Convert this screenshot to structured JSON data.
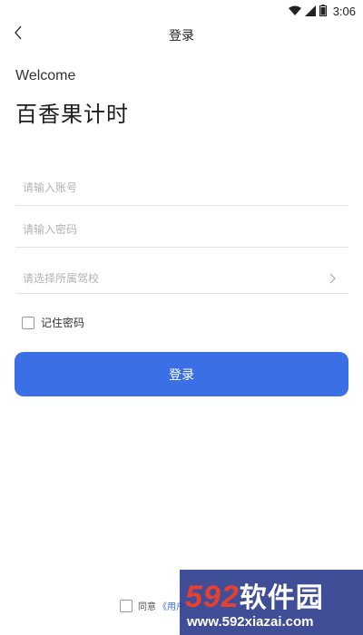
{
  "status_bar": {
    "time": "3:06",
    "icons": [
      "wifi-icon",
      "signal-icon",
      "battery-icon"
    ]
  },
  "nav": {
    "title": "登录",
    "back_icon": "chevron-left-icon"
  },
  "header": {
    "welcome": "Welcome",
    "app_name": "百香果计时"
  },
  "form": {
    "account_placeholder": "请输入账号",
    "password_placeholder": "请输入密码",
    "school_placeholder": "请选择所属驾校",
    "school_icon": "chevron-right-icon",
    "remember_label": "记住密码",
    "remember_checked": false,
    "login_label": "登录"
  },
  "agreement": {
    "prefix": "同意",
    "link": "《用户",
    "checked": false
  },
  "watermark": {
    "logo_number": "592",
    "logo_text": "软件园",
    "url": "www.592xiazai.com"
  },
  "colors": {
    "accent": "#3b6fe6",
    "placeholder": "#b3b3b3",
    "divider": "#e3e3e3",
    "watermark_bg": "#26368a",
    "watermark_number": "#e8402f"
  }
}
